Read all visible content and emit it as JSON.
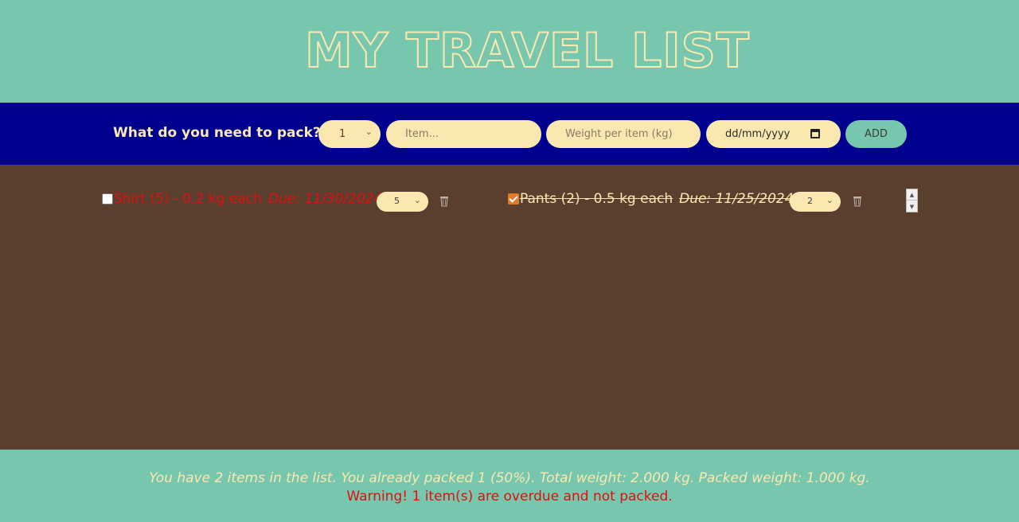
{
  "header": {
    "title": "MY TRAVEL LIST"
  },
  "form": {
    "label": "What do you need to pack?",
    "quantity_value": "1",
    "item_placeholder": "Item...",
    "weight_placeholder": "Weight per item (kg)",
    "date_placeholder": "dd/mm/yyyy",
    "add_label": "ADD"
  },
  "items": [
    {
      "text": "Shirt (5) - 0.2 kg each",
      "due": "Due: 11/30/2024",
      "quantity": "5",
      "packed": false,
      "overdue": true
    },
    {
      "text": "Pants (2) - 0.5 kg each",
      "due": "Due: 11/25/2024",
      "quantity": "2",
      "packed": true,
      "overdue": false
    }
  ],
  "footer": {
    "stats": "You have 2 items in the list. You already packed 1 (50%). Total weight: 2.000 kg. Packed weight: 1.000 kg.",
    "warning": "Warning! 1 item(s) are overdue and not packed."
  },
  "colors": {
    "header_bg": "#76c7ad",
    "form_bg": "#00008f",
    "list_bg": "#5a3e2e",
    "cream": "#fbe7b0",
    "overdue_red": "#e01010",
    "checkbox_accent": "#e07a2a"
  },
  "icons": {
    "delete": "trash-icon",
    "dropdown": "chevron-down-icon",
    "calendar": "calendar-icon"
  }
}
